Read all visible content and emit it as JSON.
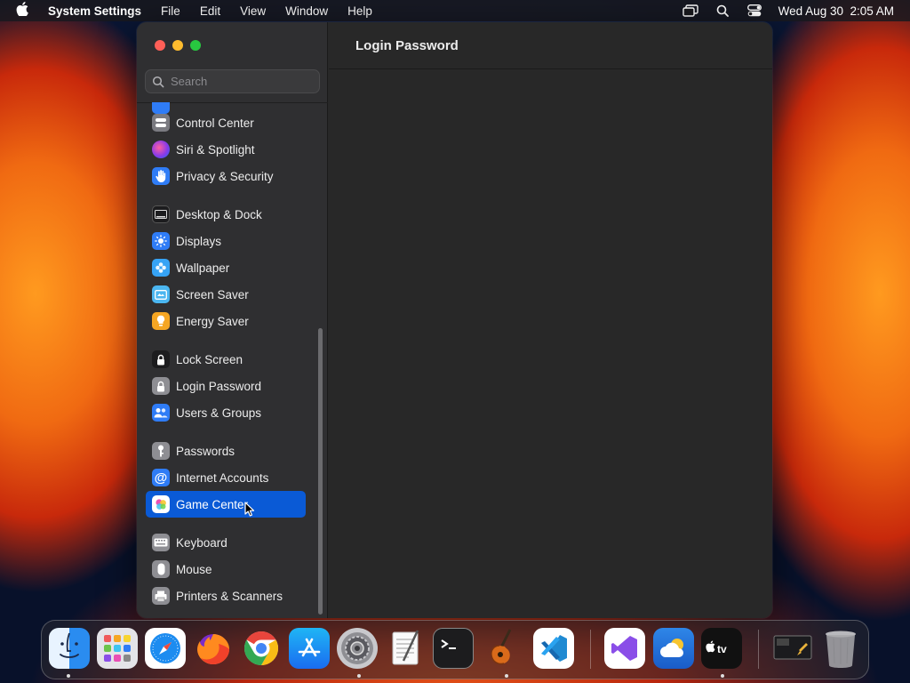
{
  "menubar": {
    "app_name": "System Settings",
    "menus": [
      "File",
      "Edit",
      "View",
      "Window",
      "Help"
    ],
    "clock": "Wed Aug 30  2:05 AM"
  },
  "window": {
    "search_placeholder": "Search",
    "content_title": "Login Password",
    "sidebar_items": [
      {
        "label": "Control Center",
        "icon": "control-center-icon",
        "color": "#7a7a80"
      },
      {
        "label": "Siri & Spotlight",
        "icon": "siri-icon",
        "color": "#c43ac8"
      },
      {
        "label": "Privacy & Security",
        "icon": "hand-icon",
        "color": "#2f7cf6"
      },
      {
        "label": "Desktop & Dock",
        "icon": "dock-icon",
        "color": "#1c1c1e"
      },
      {
        "label": "Displays",
        "icon": "sun-icon",
        "color": "#2f7cf6"
      },
      {
        "label": "Wallpaper",
        "icon": "flower-icon",
        "color": "#36a3f5"
      },
      {
        "label": "Screen Saver",
        "icon": "screen-saver-icon",
        "color": "#4bb6f0"
      },
      {
        "label": "Energy Saver",
        "icon": "bulb-icon",
        "color": "#f5a623"
      },
      {
        "label": "Lock Screen",
        "icon": "lock-icon",
        "color": "#1c1c1e"
      },
      {
        "label": "Login Password",
        "icon": "lock-icon",
        "color": "#8e8e93"
      },
      {
        "label": "Users & Groups",
        "icon": "users-icon",
        "color": "#2f7cf6"
      },
      {
        "label": "Passwords",
        "icon": "key-icon",
        "color": "#8e8e93"
      },
      {
        "label": "Internet Accounts",
        "icon": "at-icon",
        "color": "#2f7cf6"
      },
      {
        "label": "Game Center",
        "icon": "game-center-icon",
        "color": "#ffffff"
      },
      {
        "label": "Keyboard",
        "icon": "keyboard-icon",
        "color": "#8e8e93"
      },
      {
        "label": "Mouse",
        "icon": "mouse-icon",
        "color": "#8e8e93"
      },
      {
        "label": "Printers & Scanners",
        "icon": "printer-icon",
        "color": "#8e8e93"
      }
    ],
    "selected_item": "Game Center"
  },
  "dock": {
    "apps": [
      {
        "name": "Finder",
        "icon": "finder-icon",
        "running": true
      },
      {
        "name": "Launchpad",
        "icon": "launchpad-icon",
        "running": false
      },
      {
        "name": "Safari",
        "icon": "safari-icon",
        "running": false
      },
      {
        "name": "Firefox",
        "icon": "firefox-icon",
        "running": false
      },
      {
        "name": "Chrome",
        "icon": "chrome-icon",
        "running": false
      },
      {
        "name": "App Store",
        "icon": "app-store-icon",
        "running": false
      },
      {
        "name": "System Settings",
        "icon": "system-settings-icon",
        "running": true
      },
      {
        "name": "TextEdit",
        "icon": "textedit-icon",
        "running": false
      },
      {
        "name": "Terminal",
        "icon": "terminal-icon",
        "running": false
      },
      {
        "name": "GarageBand",
        "icon": "garageband-icon",
        "running": true
      },
      {
        "name": "VS Code",
        "icon": "vscode-icon",
        "running": false
      },
      {
        "name": "Visual Studio",
        "icon": "visual-studio-icon",
        "running": false
      },
      {
        "name": "Weather",
        "icon": "weather-icon",
        "running": false
      },
      {
        "name": "Apple TV",
        "icon": "apple-tv-icon",
        "running": true
      },
      {
        "name": "Screen Capture",
        "icon": "screen-capture-icon",
        "running": false
      },
      {
        "name": "Trash",
        "icon": "trash-icon",
        "running": false
      }
    ]
  }
}
